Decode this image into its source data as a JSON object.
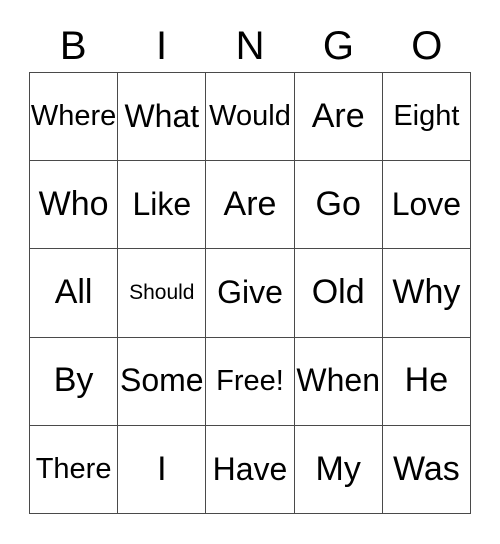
{
  "card": {
    "header_letters": [
      "B",
      "I",
      "N",
      "G",
      "O"
    ],
    "free_space_label": "Free!",
    "colors": {
      "background": "#ffffff",
      "text": "#000000",
      "gridline": "#4a4a4a"
    },
    "rows": [
      {
        "cells": [
          {
            "label": "Where"
          },
          {
            "label": "What"
          },
          {
            "label": "Would"
          },
          {
            "label": "Are"
          },
          {
            "label": "Eight"
          }
        ]
      },
      {
        "cells": [
          {
            "label": "Who"
          },
          {
            "label": "Like"
          },
          {
            "label": "Are"
          },
          {
            "label": "Go"
          },
          {
            "label": "Love"
          }
        ]
      },
      {
        "cells": [
          {
            "label": "All"
          },
          {
            "label": "Should"
          },
          {
            "label": "Give"
          },
          {
            "label": "Old"
          },
          {
            "label": "Why"
          }
        ]
      },
      {
        "cells": [
          {
            "label": "By"
          },
          {
            "label": "Some"
          },
          {
            "label": "Free!"
          },
          {
            "label": "When"
          },
          {
            "label": "He"
          }
        ]
      },
      {
        "cells": [
          {
            "label": "There"
          },
          {
            "label": "I"
          },
          {
            "label": "Have"
          },
          {
            "label": "My"
          },
          {
            "label": "Was"
          }
        ]
      }
    ]
  }
}
